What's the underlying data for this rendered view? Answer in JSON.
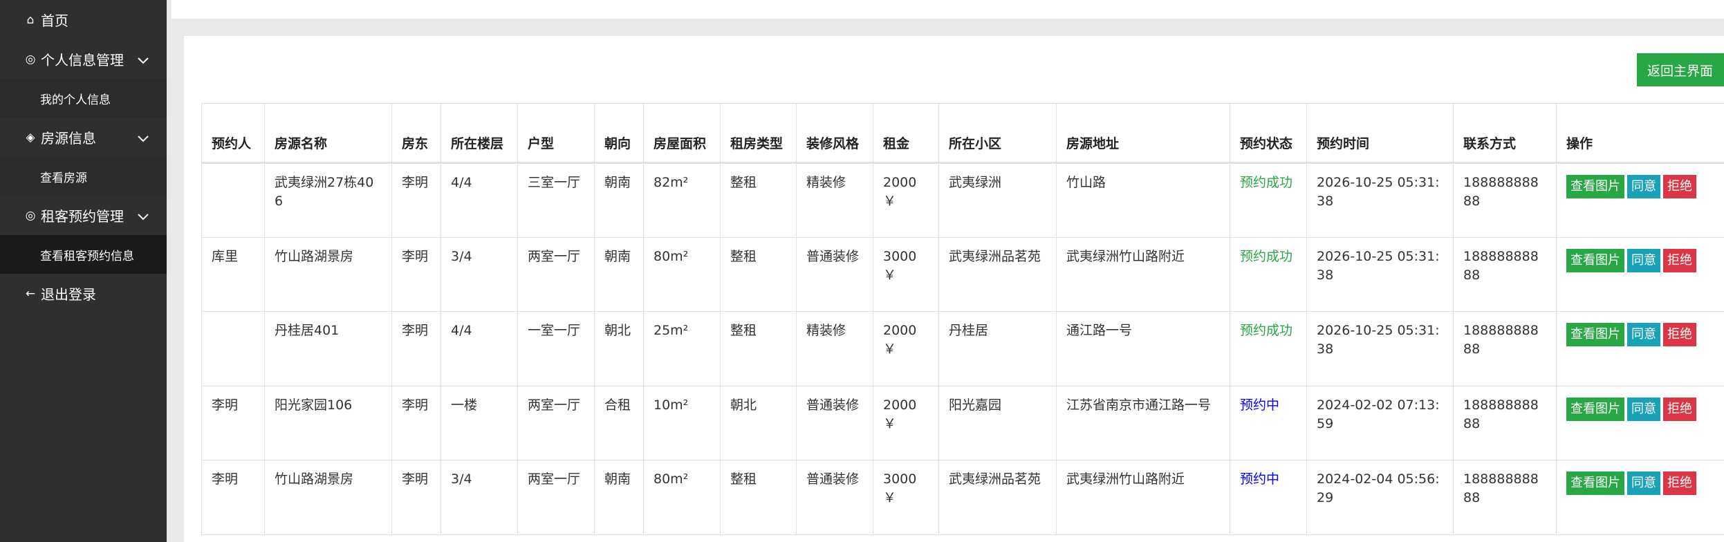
{
  "sidebar": {
    "home": {
      "icon": "home-icon",
      "label": "首页"
    },
    "personal": {
      "icon": "user-circle-icon",
      "label": "个人信息管理",
      "sub": "我的个人信息"
    },
    "housing": {
      "icon": "layers-icon",
      "label": "房源信息",
      "sub": "查看房源"
    },
    "tenant": {
      "icon": "user-circle-icon",
      "label": "租客预约管理",
      "sub": "查看租客预约信息"
    },
    "logout": {
      "icon": "arrow-left-icon",
      "label": "退出登录"
    }
  },
  "return_button": "返回主界面",
  "table": {
    "headers": [
      "预约人",
      "房源名称",
      "房东",
      "所在楼层",
      "户型",
      "朝向",
      "房屋面积",
      "租房类型",
      "装修风格",
      "租金",
      "所在小区",
      "房源地址",
      "预约状态",
      "预约时间",
      "联系方式",
      "操作"
    ],
    "area_unit": "m²",
    "buttons": {
      "view": "查看图片",
      "agree": "同意",
      "reject": "拒绝"
    },
    "rows": [
      {
        "booker": "",
        "name": "武夷绿洲27栋406",
        "landlord": "李明",
        "floor": "4/4",
        "layout": "三室一厅",
        "orient": "朝南",
        "area": "82m²",
        "type": "整租",
        "deco": "精装修",
        "rent": "2000￥",
        "community": "武夷绿洲",
        "address": "竹山路",
        "status": "预约成功",
        "status_kind": "ok",
        "time": "2026-10-25 05:31:38",
        "phone": "18888888888"
      },
      {
        "booker": "库里",
        "name": "竹山路湖景房",
        "landlord": "李明",
        "floor": "3/4",
        "layout": "两室一厅",
        "orient": "朝南",
        "area": "80m²",
        "type": "整租",
        "deco": "普通装修",
        "rent": "3000￥",
        "community": "武夷绿洲品茗苑",
        "address": "武夷绿洲竹山路附近",
        "status": "预约成功",
        "status_kind": "ok",
        "time": "2026-10-25 05:31:38",
        "phone": "18888888888"
      },
      {
        "booker": "",
        "name": "丹桂居401",
        "landlord": "李明",
        "floor": "4/4",
        "layout": "一室一厅",
        "orient": "朝北",
        "area": "25m²",
        "type": "整租",
        "deco": "精装修",
        "rent": "2000￥",
        "community": "丹桂居",
        "address": "通江路一号",
        "status": "预约成功",
        "status_kind": "ok",
        "time": "2026-10-25 05:31:38",
        "phone": "18888888888"
      },
      {
        "booker": "李明",
        "name": "阳光家园106",
        "landlord": "李明",
        "floor": "一楼",
        "layout": "两室一厅",
        "orient": "合租",
        "area": "10m²",
        "type": "朝北",
        "deco": "普通装修",
        "rent": "2000￥",
        "community": "阳光嘉园",
        "address": "江苏省南京市通江路一号",
        "status": "预约中",
        "status_kind": "wait",
        "time": "2024-02-02 07:13:59",
        "phone": "18888888888"
      },
      {
        "booker": "李明",
        "name": "竹山路湖景房",
        "landlord": "李明",
        "floor": "3/4",
        "layout": "两室一厅",
        "orient": "朝南",
        "area": "80m²",
        "type": "整租",
        "deco": "普通装修",
        "rent": "3000￥",
        "community": "武夷绿洲品茗苑",
        "address": "武夷绿洲竹山路附近",
        "status": "预约中",
        "status_kind": "wait",
        "time": "2024-02-04 05:56:29",
        "phone": "18888888888"
      }
    ]
  }
}
